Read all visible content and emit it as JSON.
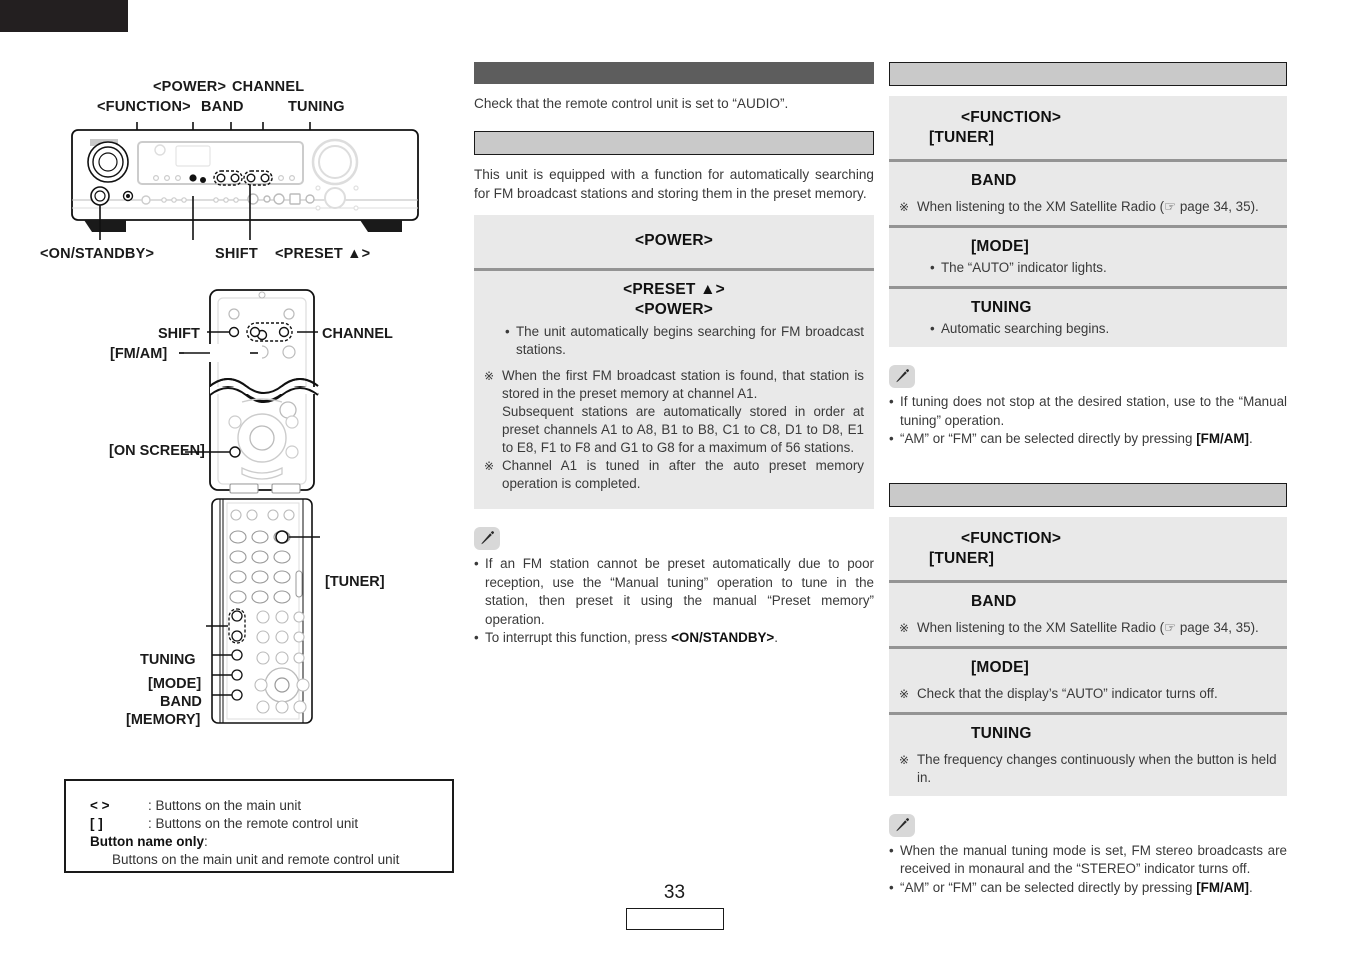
{
  "page": {
    "number": "33"
  },
  "left": {
    "unit_callouts_top": [
      {
        "label": "<FUNCTION>"
      },
      {
        "label": "<POWER>"
      },
      {
        "label": "BAND"
      },
      {
        "label": "CHANNEL"
      },
      {
        "label": "TUNING"
      }
    ],
    "unit_callouts_bottom": [
      {
        "label": "<ON/STANDBY>"
      },
      {
        "label": "SHIFT"
      },
      {
        "label": "<PRESET ▲>"
      }
    ],
    "remote_top_callouts": [
      {
        "label": "SHIFT"
      },
      {
        "label": "[FM/AM]"
      },
      {
        "label": "CHANNEL"
      },
      {
        "label": "[ON SCREEN]"
      }
    ],
    "remote_bottom_callouts": [
      {
        "label": "[TUNER]"
      },
      {
        "label": "TUNING"
      },
      {
        "label": "[MODE]"
      },
      {
        "label": "BAND"
      },
      {
        "label": "[MEMORY]"
      }
    ],
    "legend": {
      "row1_symbol": "<    >",
      "row1_text": ": Buttons on the main unit",
      "row2_symbol": "[     ]",
      "row2_text": ": Buttons on the remote control unit",
      "row3_strong": "Button name only",
      "row3_colon": ":",
      "row4_text": "Buttons on the main unit and remote control unit"
    }
  },
  "middle": {
    "header_dark_title": "",
    "intro_text": "Check that the remote control unit is set to “AUDIO”.",
    "header_light_title": "",
    "description": "This unit is equipped with a function for automatically searching for FM broadcast stations and storing them in the preset memory.",
    "steps": [
      {
        "title": "<POWER>",
        "title2": "",
        "lines": []
      },
      {
        "title": "<PRESET ▲>",
        "title2": "<POWER>",
        "lines": [
          {
            "kind": "bullet",
            "text": "The unit automatically begins searching for FM broadcast stations."
          },
          {
            "kind": "note",
            "text": "When the first FM broadcast station is found, that station is stored in the preset memory at channel A1."
          },
          {
            "kind": "plain",
            "text": "Subsequent stations are automatically stored in order at preset channels A1 to A8, B1 to B8, C1 to C8, D1 to D8, E1 to E8, F1 to F8 and G1 to G8 for a maximum of 56 stations."
          },
          {
            "kind": "note",
            "text": "Channel A1 is tuned in after the auto preset memory operation is completed."
          }
        ]
      }
    ],
    "memo": {
      "items": [
        {
          "pre": "If an FM station cannot be preset automatically due to poor reception, use the “Manual tuning” operation to tune in the station, then preset it using the manual “Preset memory” operation.",
          "bold": "",
          "post": ""
        },
        {
          "pre": "To interrupt this function, press ",
          "bold": "<ON/STANDBY>",
          "post": "."
        }
      ]
    }
  },
  "right": {
    "section1": {
      "header_title": "",
      "steps": [
        {
          "title": "<FUNCTION>",
          "title2": "[TUNER]",
          "lines": []
        },
        {
          "title": "BAND",
          "lines": [
            {
              "kind": "note",
              "text": "When listening to the XM Satellite Radio (☞ page 34, 35)."
            }
          ]
        },
        {
          "title": "[MODE]",
          "lines": [
            {
              "kind": "bullet",
              "text": "The “AUTO” indicator lights."
            }
          ]
        },
        {
          "title": "TUNING",
          "lines": [
            {
              "kind": "bullet",
              "text": "Automatic searching begins."
            }
          ]
        }
      ],
      "memo": {
        "items": [
          {
            "pre": "If tuning does not stop at the desired station, use to the “Manual tuning” operation.",
            "bold": "",
            "post": ""
          },
          {
            "pre": "“AM” or “FM” can be selected directly by pressing ",
            "bold": "[FM/AM]",
            "post": "."
          }
        ]
      }
    },
    "section2": {
      "header_title": "",
      "steps": [
        {
          "title": "<FUNCTION>",
          "title2": "[TUNER]",
          "lines": []
        },
        {
          "title": "BAND",
          "lines": [
            {
              "kind": "note",
              "text": "When listening to the XM Satellite Radio (☞ page 34, 35)."
            }
          ]
        },
        {
          "title": "[MODE]",
          "lines": [
            {
              "kind": "note",
              "text": "Check that the display’s “AUTO” indicator turns off."
            }
          ]
        },
        {
          "title": "TUNING",
          "lines": [
            {
              "kind": "note",
              "text": "The frequency changes continuously when the button is held in."
            }
          ]
        }
      ],
      "memo": {
        "items": [
          {
            "pre": "When the manual tuning mode is set, FM stereo broadcasts are received in monaural and the “STEREO” indicator turns off.",
            "bold": "",
            "post": ""
          },
          {
            "pre": "“AM” or “FM” can be selected directly by pressing ",
            "bold": "[FM/AM]",
            "post": "."
          }
        ]
      }
    }
  },
  "colors": {
    "header_dark": "#5d5d5d",
    "header_light": "#c9c9c9",
    "step_bg": "#e9e9e9",
    "separator": "#949494",
    "black": "#231f20"
  }
}
